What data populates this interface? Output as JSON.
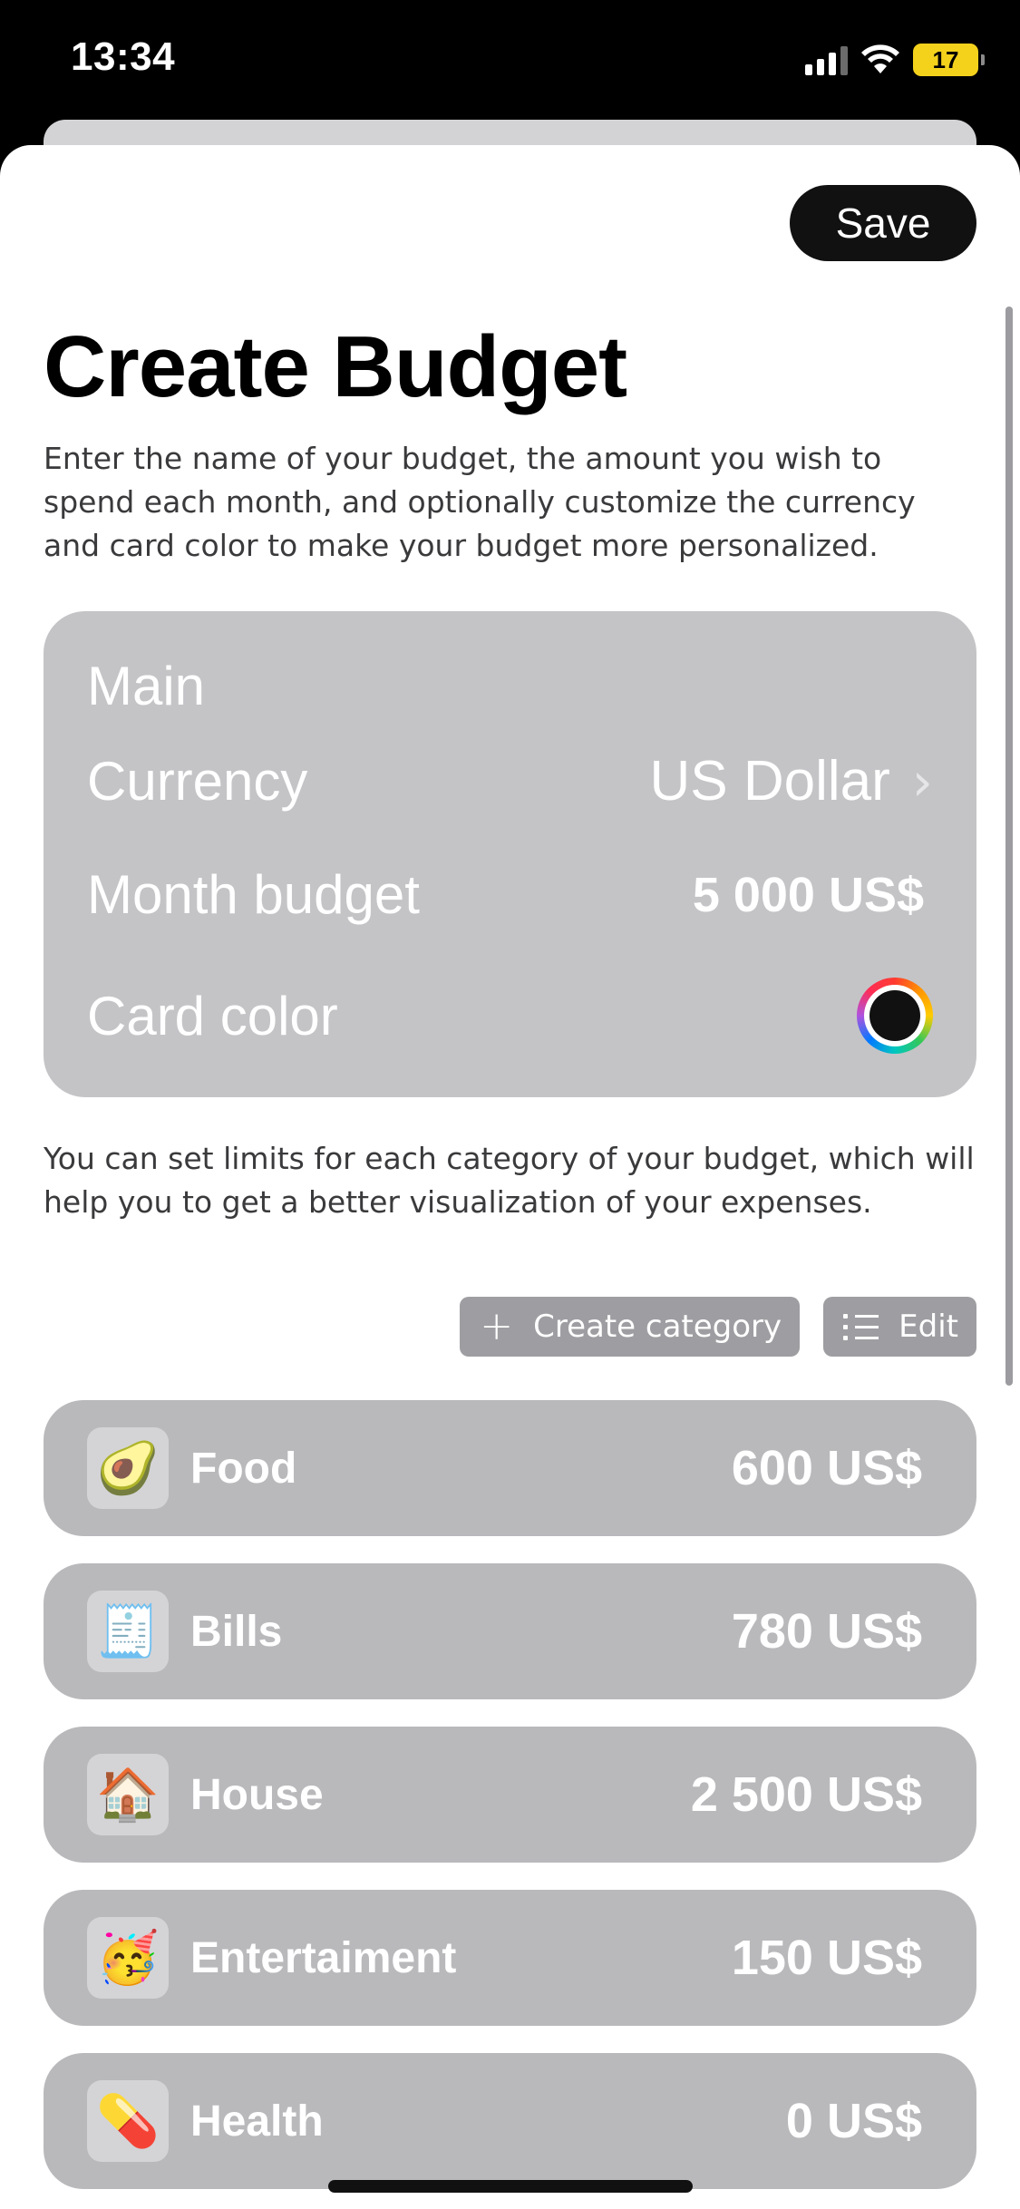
{
  "status_bar": {
    "time": "13:34",
    "battery": "17"
  },
  "header": {
    "save_label": "Save",
    "title": "Create Budget"
  },
  "intro_text": "Enter the name of your budget, the amount you wish to spend each month, and optionally customize the currency and card color to make your budget more personalized.",
  "settings": {
    "name_value": "Main",
    "currency_label": "Currency",
    "currency_value": "US Dollar",
    "month_label": "Month budget",
    "month_value": "5 000 US$",
    "color_label": "Card color",
    "card_color": "#111111"
  },
  "limits_text": "You can set limits for each category of your budget, which will help you to get a better visualization of your expenses.",
  "actions": {
    "create_label": "Create category",
    "edit_label": "Edit"
  },
  "categories": [
    {
      "icon": "🥑",
      "icon_name": "avocado-icon",
      "name": "Food",
      "amount": "600 US$"
    },
    {
      "icon": "🧾",
      "icon_name": "receipt-icon",
      "name": "Bills",
      "amount": "780 US$"
    },
    {
      "icon": "🏠",
      "icon_name": "house-icon",
      "name": "House",
      "amount": "2 500 US$"
    },
    {
      "icon": "🥳",
      "icon_name": "party-face-icon",
      "name": "Entertaiment",
      "amount": "150 US$"
    },
    {
      "icon": "💊",
      "icon_name": "pill-icon",
      "name": "Health",
      "amount": "0 US$"
    }
  ],
  "colors": {
    "card_bg": "#c4c4c7",
    "category_bg": "#b9b9bc",
    "chip_bg": "#9e9ea2",
    "save_bg": "#111111"
  }
}
